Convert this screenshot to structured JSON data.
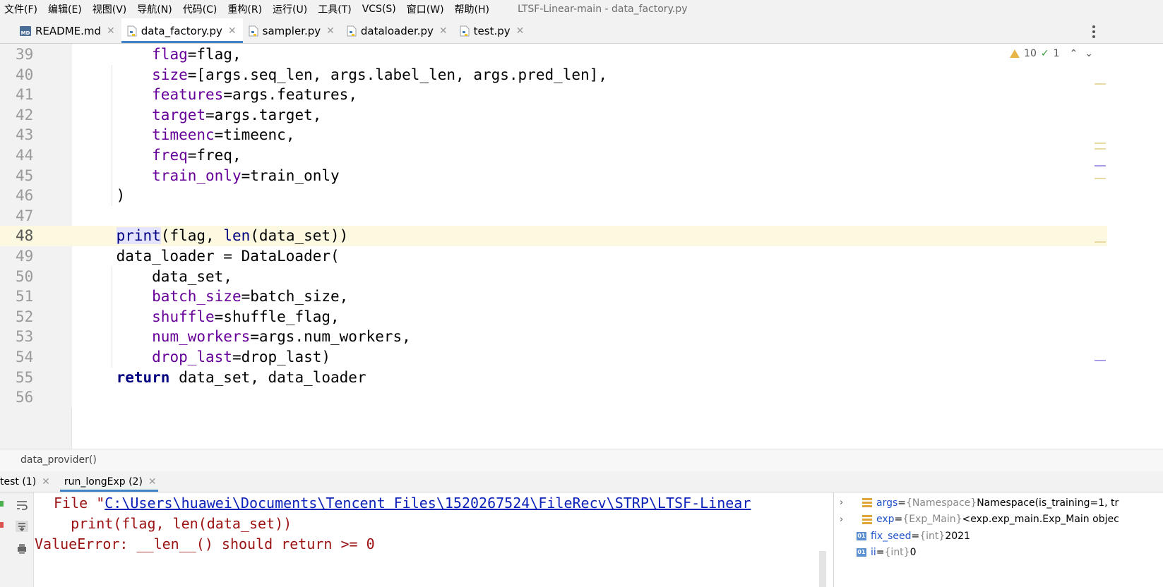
{
  "menu": [
    "文件(F)",
    "编辑(E)",
    "视图(V)",
    "导航(N)",
    "代码(C)",
    "重构(R)",
    "运行(U)",
    "工具(T)",
    "VCS(S)",
    "窗口(W)",
    "帮助(H)"
  ],
  "window_title": "LTSF-Linear-main - data_factory.py",
  "tabs": [
    {
      "label": "README.md",
      "icon": "markdown-file-icon",
      "icon_text": "MD",
      "active": false
    },
    {
      "label": "data_factory.py",
      "icon": "python-file-icon",
      "active": true
    },
    {
      "label": "sampler.py",
      "icon": "python-file-icon",
      "active": false
    },
    {
      "label": "dataloader.py",
      "icon": "python-file-icon",
      "active": false
    },
    {
      "label": "test.py",
      "icon": "python-file-icon",
      "active": false
    }
  ],
  "tab_close_glyph": "✕",
  "inspections": {
    "warnings": "10",
    "weak_warnings": "1"
  },
  "code_lines": [
    {
      "num": "39",
      "html": "        <span class=\"pa\">flag</span>=flag,"
    },
    {
      "num": "40",
      "html": "        <span class=\"pa\">size</span>=[args.seq_len, args.label_len, args.pred_len],"
    },
    {
      "num": "41",
      "html": "        <span class=\"pa\">features</span>=args.features,"
    },
    {
      "num": "42",
      "html": "        <span class=\"pa\">target</span>=args.target,"
    },
    {
      "num": "43",
      "html": "        <span class=\"pa\">timeenc</span>=timeenc,"
    },
    {
      "num": "44",
      "html": "        <span class=\"pa\">freq</span>=freq,"
    },
    {
      "num": "45",
      "html": "        <span class=\"pa\">train_only</span>=train_only"
    },
    {
      "num": "46",
      "html": "    )"
    },
    {
      "num": "47",
      "html": ""
    },
    {
      "num": "48",
      "html": "    <span class=\"bi-hl\">print</span>(flag, <span class=\"bi\">len</span>(data_set))",
      "highlight": true
    },
    {
      "num": "49",
      "html": "    data_loader = DataLoader("
    },
    {
      "num": "50",
      "html": "        data_set,"
    },
    {
      "num": "51",
      "html": "        <span class=\"pa\">batch_size</span>=batch_size,"
    },
    {
      "num": "52",
      "html": "        <span class=\"pa\">shuffle</span>=shuffle_flag,"
    },
    {
      "num": "53",
      "html": "        <span class=\"pa\">num_workers</span>=args.num_workers,"
    },
    {
      "num": "54",
      "html": "        <span class=\"pa\">drop_last</span>=drop_last)"
    },
    {
      "num": "55",
      "html": "    <span class=\"kw\">return</span> data_set, data_loader"
    },
    {
      "num": "56",
      "html": ""
    }
  ],
  "breadcrumb": "data_provider()",
  "run_tabs": [
    {
      "label": "test (1)",
      "active": false
    },
    {
      "label": "run_longExp (2)",
      "active": true
    }
  ],
  "console": {
    "file_prefix": "File \"",
    "file_link": "C:\\Users\\huawei\\Documents\\Tencent Files\\1520267524\\FileRecv\\STRP\\LTSF-Linear",
    "line2": "  print(flag, len(data_set))",
    "line3": "ValueError: __len__() should return >= 0"
  },
  "variables": [
    {
      "name": "args",
      "type": "{Namespace}",
      "value": "Namespace(is_training=1, tr",
      "expandable": true,
      "icon": "object-icon"
    },
    {
      "name": "exp",
      "type": "{Exp_Main}",
      "value": "<exp.exp_main.Exp_Main objec",
      "expandable": true,
      "icon": "object-icon"
    },
    {
      "name": "fix_seed",
      "type": "{int}",
      "value": "2021",
      "expandable": false,
      "icon": "int-icon",
      "icon_text": "01"
    },
    {
      "name": "ii",
      "type": "{int}",
      "value": "0",
      "expandable": false,
      "icon": "int-icon",
      "icon_text": "01"
    }
  ]
}
